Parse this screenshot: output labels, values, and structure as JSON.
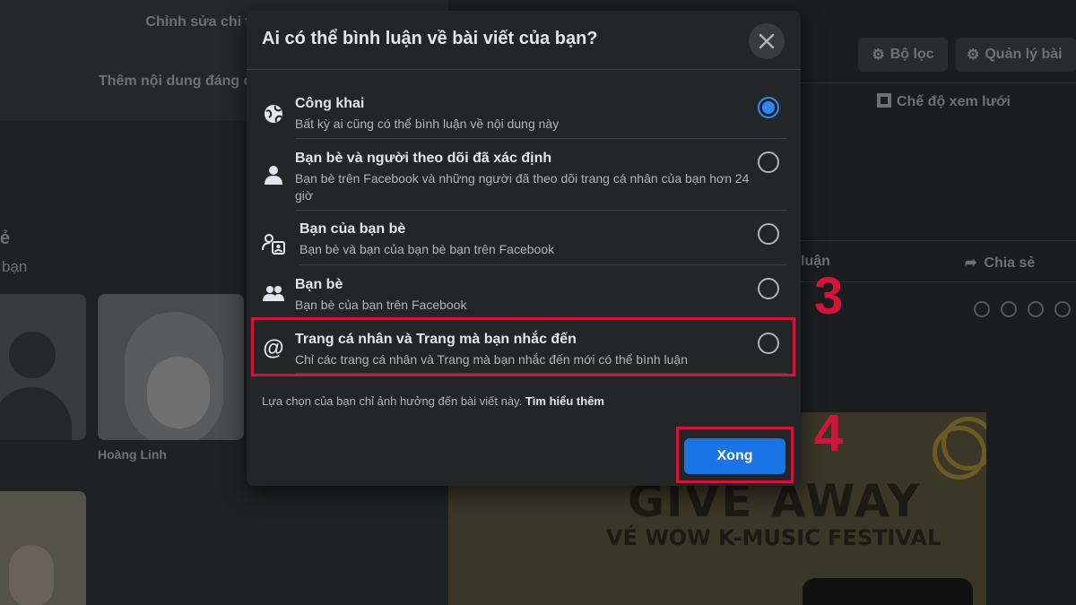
{
  "background": {
    "edit_details": "Chỉnh sửa chi tiết",
    "add_featured": "Thêm nội dung đáng chú",
    "friends_heading_fragment": "ẻ",
    "friends_sub_fragment": "bạn",
    "friend_name": "Hoàng Linh",
    "filter_label": "Bộ lọc",
    "manage_label": "Quản lý bài",
    "grid_view_label": "Chế độ xem lưới",
    "comment_fragment": "luận",
    "share_label": "Chia sẻ",
    "giveaway_title": "GIVE AWAY",
    "giveaway_subtitle": "VÉ WOW K-MUSIC FESTIVAL"
  },
  "modal": {
    "title": "Ai có thể bình luận về bài viết của bạn?",
    "options": [
      {
        "icon": "globe-icon",
        "title": "Công khai",
        "desc": "Bất kỳ ai cũng có thể bình luận về nội dung này",
        "selected": true
      },
      {
        "icon": "person-icon",
        "title": "Bạn bè và người theo dõi đã xác định",
        "desc": "Bạn bè trên Facebook và những người đã theo dõi trang cá nhân của bạn hơn 24 giờ",
        "selected": false
      },
      {
        "icon": "friends-of-friends-icon",
        "title": "Bạn của bạn bè",
        "desc": "Bạn bè và bạn của bạn bè bạn trên Facebook",
        "selected": false
      },
      {
        "icon": "friends-icon",
        "title": "Bạn bè",
        "desc": "Bạn bè của bạn trên Facebook",
        "selected": false
      },
      {
        "icon": "at-sign-icon",
        "title": "Trang cá nhân và Trang mà bạn nhắc đến",
        "desc": "Chỉ các trang cá nhân và Trang mà bạn nhắc đến mới có thể bình luận",
        "selected": false
      }
    ],
    "footnote": "Lựa chọn của bạn chỉ ảnh hưởng đến bài viết này.",
    "learn_more": "Tìm hiểu thêm",
    "done_label": "Xong"
  },
  "annotations": {
    "step_3": "3",
    "step_4": "4"
  },
  "colors": {
    "accent": "#1b74e4",
    "radio_selected": "#2e89ff",
    "highlight": "#d2143a",
    "modal_bg": "#242526"
  }
}
